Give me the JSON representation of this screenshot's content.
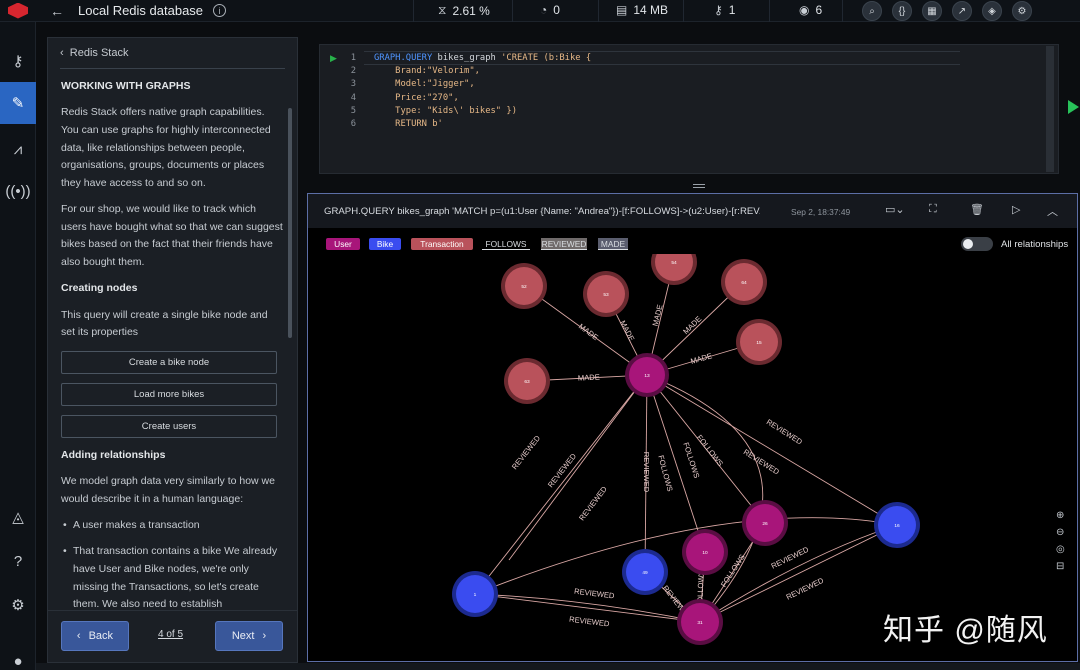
{
  "topbar": {
    "db_title": "Local Redis database",
    "stats": [
      {
        "icon": "cpu-icon",
        "value": "2.61 %"
      },
      {
        "icon": "gauge-icon",
        "value": "0"
      },
      {
        "icon": "memory-icon",
        "value": "14 MB"
      },
      {
        "icon": "key-icon",
        "value": "1"
      },
      {
        "icon": "user-icon",
        "value": "6"
      }
    ]
  },
  "tutorial": {
    "breadcrumb": "Redis Stack",
    "section_title": "WORKING WITH GRAPHS",
    "p1": "Redis Stack offers native graph capabilities. You can use graphs for highly interconnected data, like relationships between people, organisations, groups, documents or places they have access to and so on.",
    "p2": "For our shop, we would like to track which users have bought what so that we can suggest bikes based on the fact that their friends have also bought them.",
    "h_creating": "Creating nodes",
    "p3": "This query will create a single bike node and set its properties",
    "btn_create_bike": "Create a bike node",
    "btn_load_bikes": "Load more bikes",
    "btn_create_users": "Create users",
    "h_relationships": "Adding relationships",
    "p4": "We model graph data very similarly to how we would describe it in a human language:",
    "li1": "A user makes a transaction",
    "li2": "That transaction contains a bike We already have User and Bike nodes, we're only missing the Transactions, so let's create them. We also need to establish",
    "back_label": "Back",
    "page_indicator": "4 of 5",
    "next_label": "Next"
  },
  "editor": {
    "line_numbers": [
      "1",
      "2",
      "3",
      "4",
      "5",
      "6"
    ],
    "line1_kw": "GRAPH.QUERY",
    "line1_rest": " bikes_graph ",
    "line1_str": "'CREATE (b:Bike {",
    "line2": "    Brand:\"Velorim\",",
    "line3": "    Model:\"Jigger\",",
    "line4": "    Price:\"270\",",
    "line5": "    Type: \"Kids\\' bikes\" })",
    "line6": "    RETURN b'"
  },
  "result": {
    "query": "GRAPH.QUERY bikes_graph 'MATCH p=(u1:User {Name: \"Andrea\"})-[f:FOLLOWS]->(u2:User)-[r:REV...",
    "timestamp": "Sep 2, 18:37:49",
    "legend": [
      {
        "label": "User",
        "color": "#a8157a"
      },
      {
        "label": "Bike",
        "color": "#3a4cf0"
      },
      {
        "label": "Transaction",
        "color": "#b9525b"
      },
      {
        "label": "FOLLOWS"
      },
      {
        "label": "REVIEWED"
      },
      {
        "label": "MADE"
      }
    ],
    "toggle_label": "All relationships",
    "graph": {
      "edge_labels": {
        "made": "MADE",
        "follows": "FOLLOWS",
        "reviewed": "REVIEWED"
      },
      "node_labels": {
        "t1": "52",
        "t2": "53",
        "t3": "54",
        "t4": "64",
        "t5": "15",
        "t6": "63",
        "hub": "13",
        "u26": "26",
        "u10": "10",
        "u31": "31",
        "b1": "1",
        "b49": "49",
        "b16": "16"
      },
      "colors": {
        "user": "#a8157a",
        "bike": "#3a4cf0",
        "transaction": "#b9525b",
        "edge": "#d9a7a4"
      }
    }
  },
  "watermark": "知乎 @随风"
}
